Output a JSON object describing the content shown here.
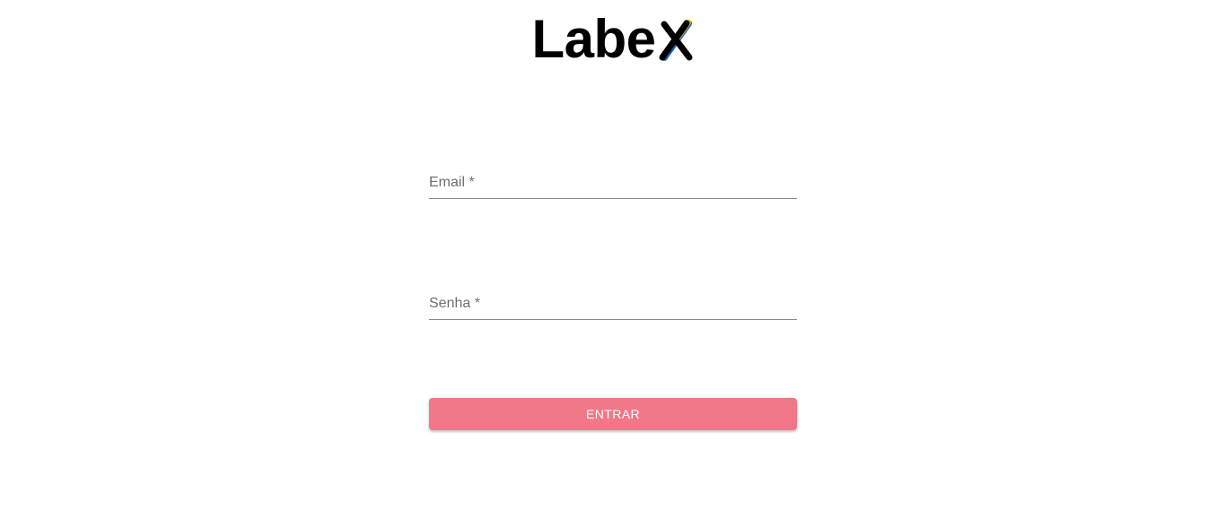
{
  "logo": {
    "text": "Labe",
    "x_glyph": "X"
  },
  "form": {
    "email": {
      "label": "Email *",
      "value": ""
    },
    "senha": {
      "label": "Senha *",
      "value": ""
    },
    "submit_label": "ENTRAR"
  },
  "colors": {
    "button_bg": "#f07888",
    "button_text": "#ffffff",
    "field_underline": "#8c8c8c",
    "label_text": "#6f6f6f",
    "logo_x_left": "#000000",
    "logo_x_right_top": "#f2c400",
    "logo_x_right_bottom": "#1565c0"
  }
}
